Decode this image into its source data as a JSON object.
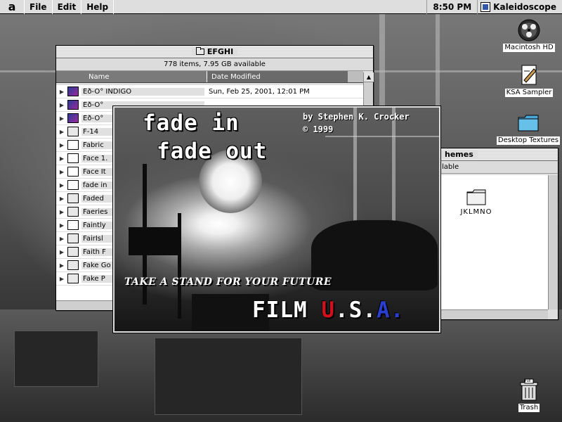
{
  "menubar": {
    "apple_glyph": "a",
    "menus": [
      "File",
      "Edit",
      "Help"
    ],
    "clock": "8:50 PM",
    "active_app": "Kaleidoscope"
  },
  "desktop_icons": [
    {
      "label": "Macintosh HD",
      "icon": "hard-drive-icon"
    },
    {
      "label": "KSA Sampler",
      "icon": "document-icon"
    },
    {
      "label": "Desktop Textures",
      "icon": "folder-icon"
    },
    {
      "label": "Trash",
      "icon": "trash-icon",
      "badge": "Full"
    }
  ],
  "finder_window": {
    "title": "EFGHI",
    "info": "778 items, 7.95 GB available",
    "columns": {
      "name": "Name",
      "date": "Date Modified"
    },
    "rows": [
      {
        "name": "Éð-Ö° INDIGO",
        "date": "Sun, Feb 25, 2001, 12:01 PM",
        "icon": "color-doc-icon"
      },
      {
        "name": "Éð-Ö°",
        "date": "",
        "icon": "color-doc-icon"
      },
      {
        "name": "Éð-Ö° ",
        "date": "",
        "icon": "color-doc-icon"
      },
      {
        "name": "F-14",
        "date": "",
        "icon": "folder-icon"
      },
      {
        "name": "Fabric",
        "date": "",
        "icon": "app-icon"
      },
      {
        "name": "Face 1.",
        "date": "",
        "icon": "app-icon"
      },
      {
        "name": "Face It",
        "date": "",
        "icon": "app-icon"
      },
      {
        "name": "fade in",
        "date": "",
        "icon": "app-icon"
      },
      {
        "name": "Faded",
        "date": "",
        "icon": "folder-icon"
      },
      {
        "name": "Faeries",
        "date": "",
        "icon": "folder-icon"
      },
      {
        "name": "Faintly",
        "date": "",
        "icon": "document-icon"
      },
      {
        "name": "FairIsl",
        "date": "",
        "icon": "folder-icon"
      },
      {
        "name": "Faith F",
        "date": "",
        "icon": "folder-icon"
      },
      {
        "name": "Fake Go",
        "date": "",
        "icon": "folder-icon"
      },
      {
        "name": "Fake P",
        "date": "",
        "icon": "folder-icon"
      }
    ]
  },
  "themes_window": {
    "title": "hemes",
    "info": "lable",
    "folder_label": "JKLMNO"
  },
  "splash": {
    "title_line1": "fade in",
    "title_line2": "fade out",
    "byline": "by Stephen K. Crocker",
    "copyright": "© 1999",
    "tagline": "TAKE A STAND FOR YOUR FUTURE",
    "brand_film": "FILM",
    "brand_u": "U",
    "brand_dot1": ".",
    "brand_s": "S",
    "brand_dot2": ".",
    "brand_a": "A",
    "brand_dot3": "."
  }
}
